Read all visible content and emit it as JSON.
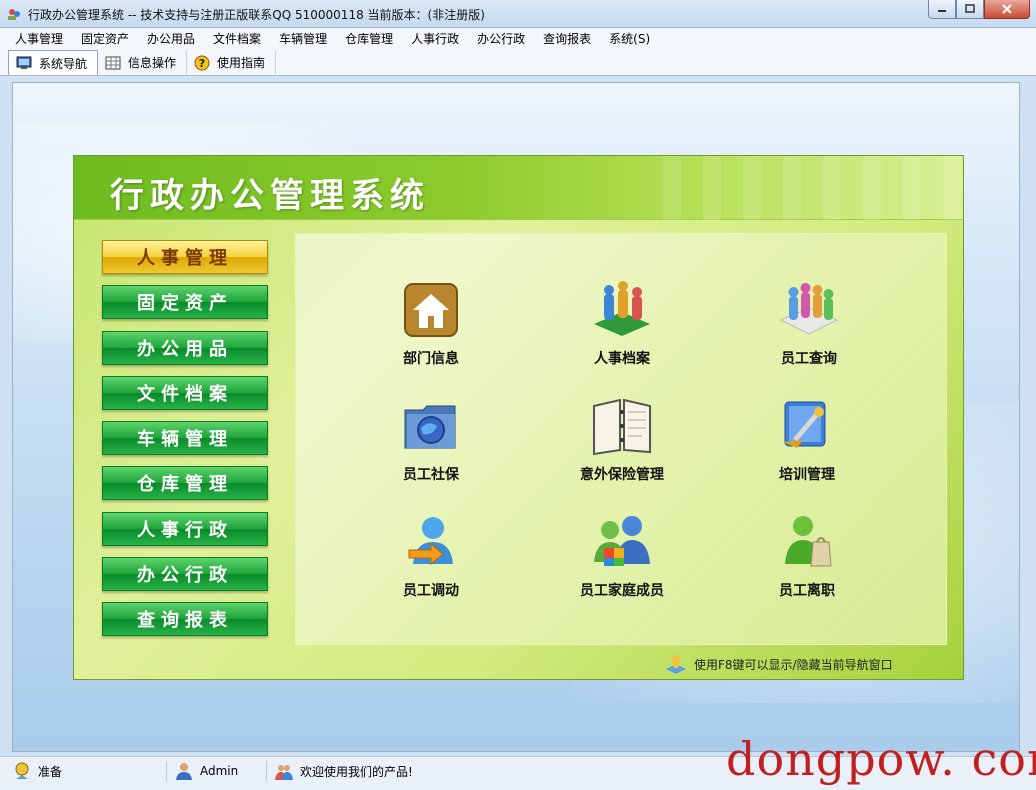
{
  "window": {
    "title": "行政办公管理系统 -- 技术支持与注册正版联系QQ 510000118   当前版本：(非注册版)",
    "icon": "app-icon"
  },
  "menu": [
    "人事管理",
    "固定资产",
    "办公用品",
    "文件档案",
    "车辆管理",
    "仓库管理",
    "人事行政",
    "办公行政",
    "查询报表",
    "系统(S)"
  ],
  "toolbar": {
    "tabs": [
      {
        "label": "系统导航",
        "icon": "monitor-icon",
        "active": true
      },
      {
        "label": "信息操作",
        "icon": "table-icon",
        "active": false
      },
      {
        "label": "使用指南",
        "icon": "help-icon",
        "active": false
      }
    ]
  },
  "panel": {
    "title": "行政办公管理系统",
    "nav": [
      "人事管理",
      "固定资产",
      "办公用品",
      "文件档案",
      "车辆管理",
      "仓库管理",
      "人事行政",
      "办公行政",
      "查询报表"
    ],
    "tiles": [
      {
        "label": "部门信息",
        "icon": "house-icon"
      },
      {
        "label": "人事档案",
        "icon": "people-book-icon"
      },
      {
        "label": "员工查询",
        "icon": "people-chart-icon"
      },
      {
        "label": "员工社保",
        "icon": "globe-folder-icon"
      },
      {
        "label": "意外保险管理",
        "icon": "open-binder-icon"
      },
      {
        "label": "培训管理",
        "icon": "book-tools-icon"
      },
      {
        "label": "员工调动",
        "icon": "user-transfer-icon"
      },
      {
        "label": "员工家庭成员",
        "icon": "user-group-icon"
      },
      {
        "label": "员工离职",
        "icon": "user-leave-icon"
      }
    ],
    "hint": "使用F8键可以显示/隐藏当前导航窗口"
  },
  "status": {
    "ready": "准备",
    "user": "Admin",
    "welcome": "欢迎使用我们的产品!"
  },
  "watermark": "dongpow. com",
  "colors": {
    "nav_green": "#1da33a",
    "nav_active": "#f5d03a",
    "header_green": "#6dbb1f"
  }
}
